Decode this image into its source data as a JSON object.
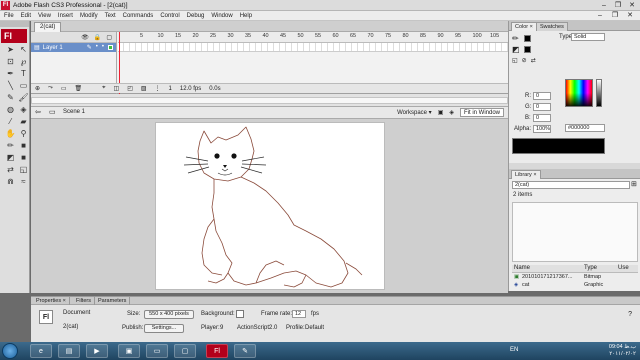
{
  "window": {
    "app_icon": "Fl",
    "title": "Adobe Flash CS3 Professional - [2(cat)]",
    "buttons": [
      "–",
      "❐",
      "✕"
    ]
  },
  "menu": {
    "items": [
      "File",
      "Edit",
      "View",
      "Insert",
      "Modify",
      "Text",
      "Commands",
      "Control",
      "Debug",
      "Window",
      "Help"
    ]
  },
  "tools": {
    "logo": "Fl"
  },
  "document": {
    "tab": "2(cat)"
  },
  "timeline": {
    "layer_name": "Layer 1",
    "frame_numbers": [
      "5",
      "10",
      "15",
      "20",
      "25",
      "30",
      "35",
      "40",
      "45",
      "50",
      "55",
      "60",
      "65",
      "70",
      "75",
      "80",
      "85",
      "90",
      "95",
      "100",
      "105"
    ],
    "status_frame": "1",
    "status_fps": "12.0 fps",
    "status_time": "0.0s"
  },
  "editbar": {
    "scene": "Scene 1",
    "workspace": "Workspace ▾",
    "zoom": "Fit in Window"
  },
  "color_panel": {
    "tabs": [
      "Color ×",
      "Swatches"
    ],
    "type_label": "Type:",
    "type_value": "Solid",
    "r_label": "R:",
    "r_value": "0",
    "g_label": "G:",
    "g_value": "0",
    "b_label": "B:",
    "b_value": "0",
    "alpha_label": "Alpha:",
    "alpha_value": "100%",
    "hex_value": "#000000",
    "preview_color": "#000000"
  },
  "library": {
    "tab": "Library ×",
    "document": "2(cat)",
    "count": "2 items",
    "col_name": "Name",
    "col_type": "Type",
    "col_use": "Use",
    "items": [
      {
        "name": "2010101712173​67...",
        "type": "Bitmap"
      },
      {
        "name": "cat",
        "type": "Graphic"
      }
    ]
  },
  "properties": {
    "tabs": [
      "Properties ×",
      "Filters",
      "Parameters"
    ],
    "doc_label": "Document",
    "doc_name": "2(cat)",
    "size_label": "Size:",
    "size_value": "550 x 400 pixels",
    "background_label": "Background:",
    "framerate_label": "Frame rate:",
    "framerate_value": "12",
    "fps_unit": "fps",
    "publish_label": "Publish:",
    "settings_button": "Settings...",
    "player_label": "Player:",
    "player_value": "9",
    "actionscript_label": "ActionScript:",
    "actionscript_value": "2.0",
    "profile_label": "Profile:",
    "profile_value": "Default"
  },
  "taskbar": {
    "lang": "EN",
    "time": "09:04 ب.ظ",
    "date": "۲۰۱۱/۰۲/۰۲"
  },
  "colors": {
    "accent": "#6a8fc9",
    "flash_red": "#b3001b",
    "cat_stroke": "#8a4a3a"
  }
}
